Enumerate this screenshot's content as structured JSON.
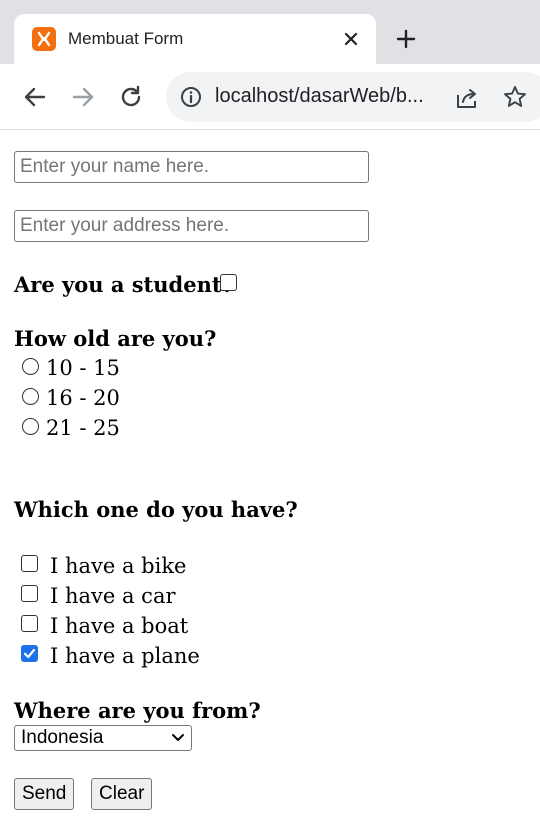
{
  "browser": {
    "tab_title": "Membuat Form",
    "url": "localhost/dasarWeb/b..."
  },
  "form": {
    "name_placeholder": "Enter your name here.",
    "address_placeholder": "Enter your address here.",
    "student_label": "Are you a student?",
    "student_checked": false,
    "age_label": "How old are you?",
    "age_options": [
      "10 - 15",
      "16 - 20",
      "21 - 25"
    ],
    "have_label": "Which one do you have?",
    "have_options": [
      {
        "label": "I have a bike",
        "checked": false
      },
      {
        "label": "I have a car",
        "checked": false
      },
      {
        "label": "I have a boat",
        "checked": false
      },
      {
        "label": "I have a plane",
        "checked": true
      }
    ],
    "from_label": "Where are you from?",
    "country_selected": "Indonesia",
    "send_label": "Send",
    "clear_label": "Clear"
  },
  "colors": {
    "accent": "#1a73e8",
    "favicon": "#f4700d"
  }
}
